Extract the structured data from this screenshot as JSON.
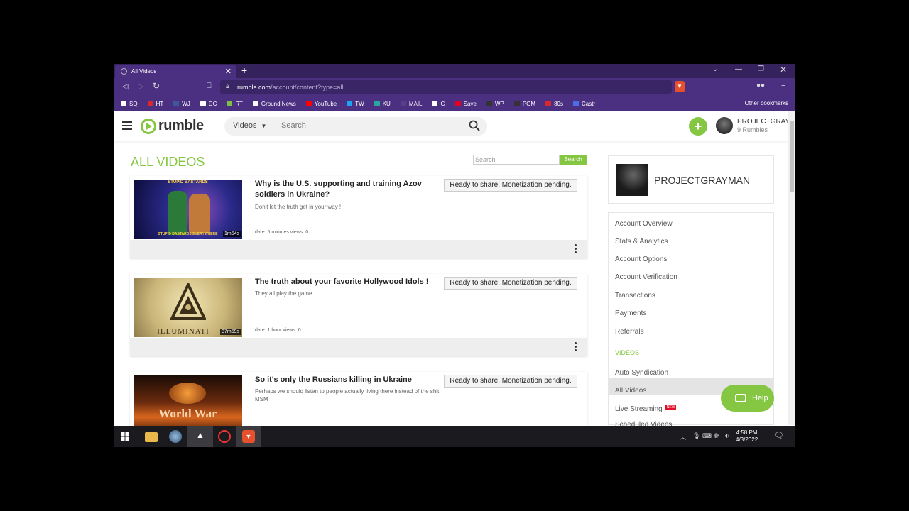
{
  "browser": {
    "tab_title": "All Videos",
    "new_tab": "+",
    "url_host": "rumble.com",
    "url_path": "/account/content?type=all",
    "bookmarks": [
      {
        "label": "SQ",
        "color": "#ffffff"
      },
      {
        "label": "HT",
        "color": "#d9272e"
      },
      {
        "label": "WJ",
        "color": "#3b5998"
      },
      {
        "label": "DC",
        "color": "#ffffff"
      },
      {
        "label": "RT",
        "color": "#7ac143"
      },
      {
        "label": "Ground News",
        "color": "#ffffff"
      },
      {
        "label": "YouTube",
        "color": "#ff0000"
      },
      {
        "label": "TW",
        "color": "#1da1f2"
      },
      {
        "label": "KU",
        "color": "#2aa5a0"
      },
      {
        "label": "MAIL",
        "color": "#5a3d8f"
      },
      {
        "label": "G",
        "color": "#ffffff"
      },
      {
        "label": "Save",
        "color": "#e60023"
      },
      {
        "label": "WP",
        "color": "#333333"
      },
      {
        "label": "PGM",
        "color": "#333333"
      },
      {
        "label": "80s",
        "color": "#d9272e"
      },
      {
        "label": "Castr",
        "color": "#4b6ee8"
      }
    ],
    "other_bookmarks": "Other bookmarks"
  },
  "header": {
    "logo_text": "rumble",
    "search_category": "Videos",
    "search_placeholder": "Search",
    "user_name": "PROJECTGRAY",
    "user_rumbles": "9 Rumbles"
  },
  "main": {
    "title": "ALL VIDEOS",
    "search_placeholder": "Search",
    "search_button": "Search",
    "videos": [
      {
        "title": "Why is the U.S. supporting and training Azov soldiers in Ukraine?",
        "description": "Don't let the truth get in your way !",
        "meta": "date: 5 minutes  views: 0",
        "duration": "1m54s",
        "status": "Ready to share. Monetization pending.",
        "thumb_top": "STUPID BASTARDS",
        "thumb_bottom": "STUPID BASTARDS EVERYWHERE"
      },
      {
        "title": "The truth about your favorite Hollywood Idols !",
        "description": "They all play the game",
        "meta": "date: 1 hour  views: 0",
        "duration": "37m59s",
        "status": "Ready to share. Monetization pending.",
        "thumb_text": "ILLUMINATI"
      },
      {
        "title": "So it's only the Russians killing in Ukraine",
        "description": "Perhaps we should listen to people actually living there instead of the shit MSM",
        "status": "Ready to share. Monetization pending.",
        "thumb_text": "World War"
      }
    ]
  },
  "sidebar": {
    "profile_name": "PROJECTGRAYMAN",
    "menu": [
      "Account Overview",
      "Stats & Analytics",
      "Account Options",
      "Account Verification",
      "Transactions",
      "Payments",
      "Referrals"
    ],
    "section_videos": "VIDEOS",
    "video_menu": [
      "Auto Syndication",
      "All Videos",
      "Live Streaming",
      "Scheduled Videos"
    ],
    "new_badge": "NEW",
    "help": "Help"
  },
  "taskbar": {
    "time": "4:58 PM",
    "date": "4/3/2022"
  }
}
